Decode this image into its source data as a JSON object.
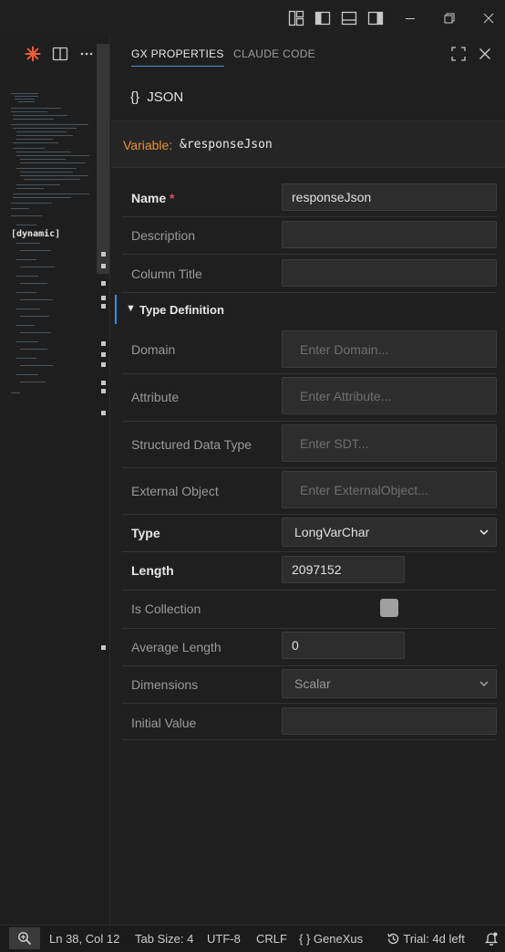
{
  "window": {
    "controls": [
      "customize-layout-icon",
      "toggle-primary-sidebar-icon",
      "toggle-panel-icon",
      "toggle-secondary-sidebar-icon",
      "minimize-icon",
      "restore-icon",
      "close-icon"
    ]
  },
  "editor": {
    "minimap_label": "[dynamic]"
  },
  "panel": {
    "tabs": [
      {
        "label": "GX PROPERTIES",
        "active": true
      },
      {
        "label": "CLAUDE CODE",
        "active": false
      }
    ],
    "object_icon": "{}",
    "object_type": "JSON",
    "variable_label": "Variable:",
    "variable_name": "&responseJson"
  },
  "properties": {
    "name": {
      "label": "Name",
      "required_mark": "*",
      "value": "responseJson"
    },
    "description": {
      "label": "Description",
      "value": ""
    },
    "column_title": {
      "label": "Column Title",
      "value": ""
    },
    "type_definition": {
      "label": "Type Definition",
      "expanded": true
    },
    "domain": {
      "label": "Domain",
      "placeholder": "Enter Domain..."
    },
    "attribute": {
      "label": "Attribute",
      "placeholder": "Enter Attribute..."
    },
    "sdt": {
      "label": "Structured Data Type",
      "placeholder": "Enter SDT..."
    },
    "external_object": {
      "label": "External Object",
      "placeholder": "Enter ExternalObject..."
    },
    "type": {
      "label": "Type",
      "value": "LongVarChar"
    },
    "length": {
      "label": "Length",
      "value": "2097152"
    },
    "is_collection": {
      "label": "Is Collection",
      "checked": false
    },
    "average_length": {
      "label": "Average Length",
      "value": "0"
    },
    "dimensions": {
      "label": "Dimensions",
      "value": "Scalar"
    },
    "initial_value": {
      "label": "Initial Value",
      "value": ""
    }
  },
  "status": {
    "position": "Ln 38, Col 12",
    "tab_size": "Tab Size: 4",
    "encoding": "UTF-8",
    "eol": "CRLF",
    "language_icon": "{ }",
    "language": "GeneXus",
    "trial": "Trial: 4d left"
  },
  "colors": {
    "accent": "#3e8ede",
    "variable_label": "#e8923b",
    "required": "#e05252"
  }
}
